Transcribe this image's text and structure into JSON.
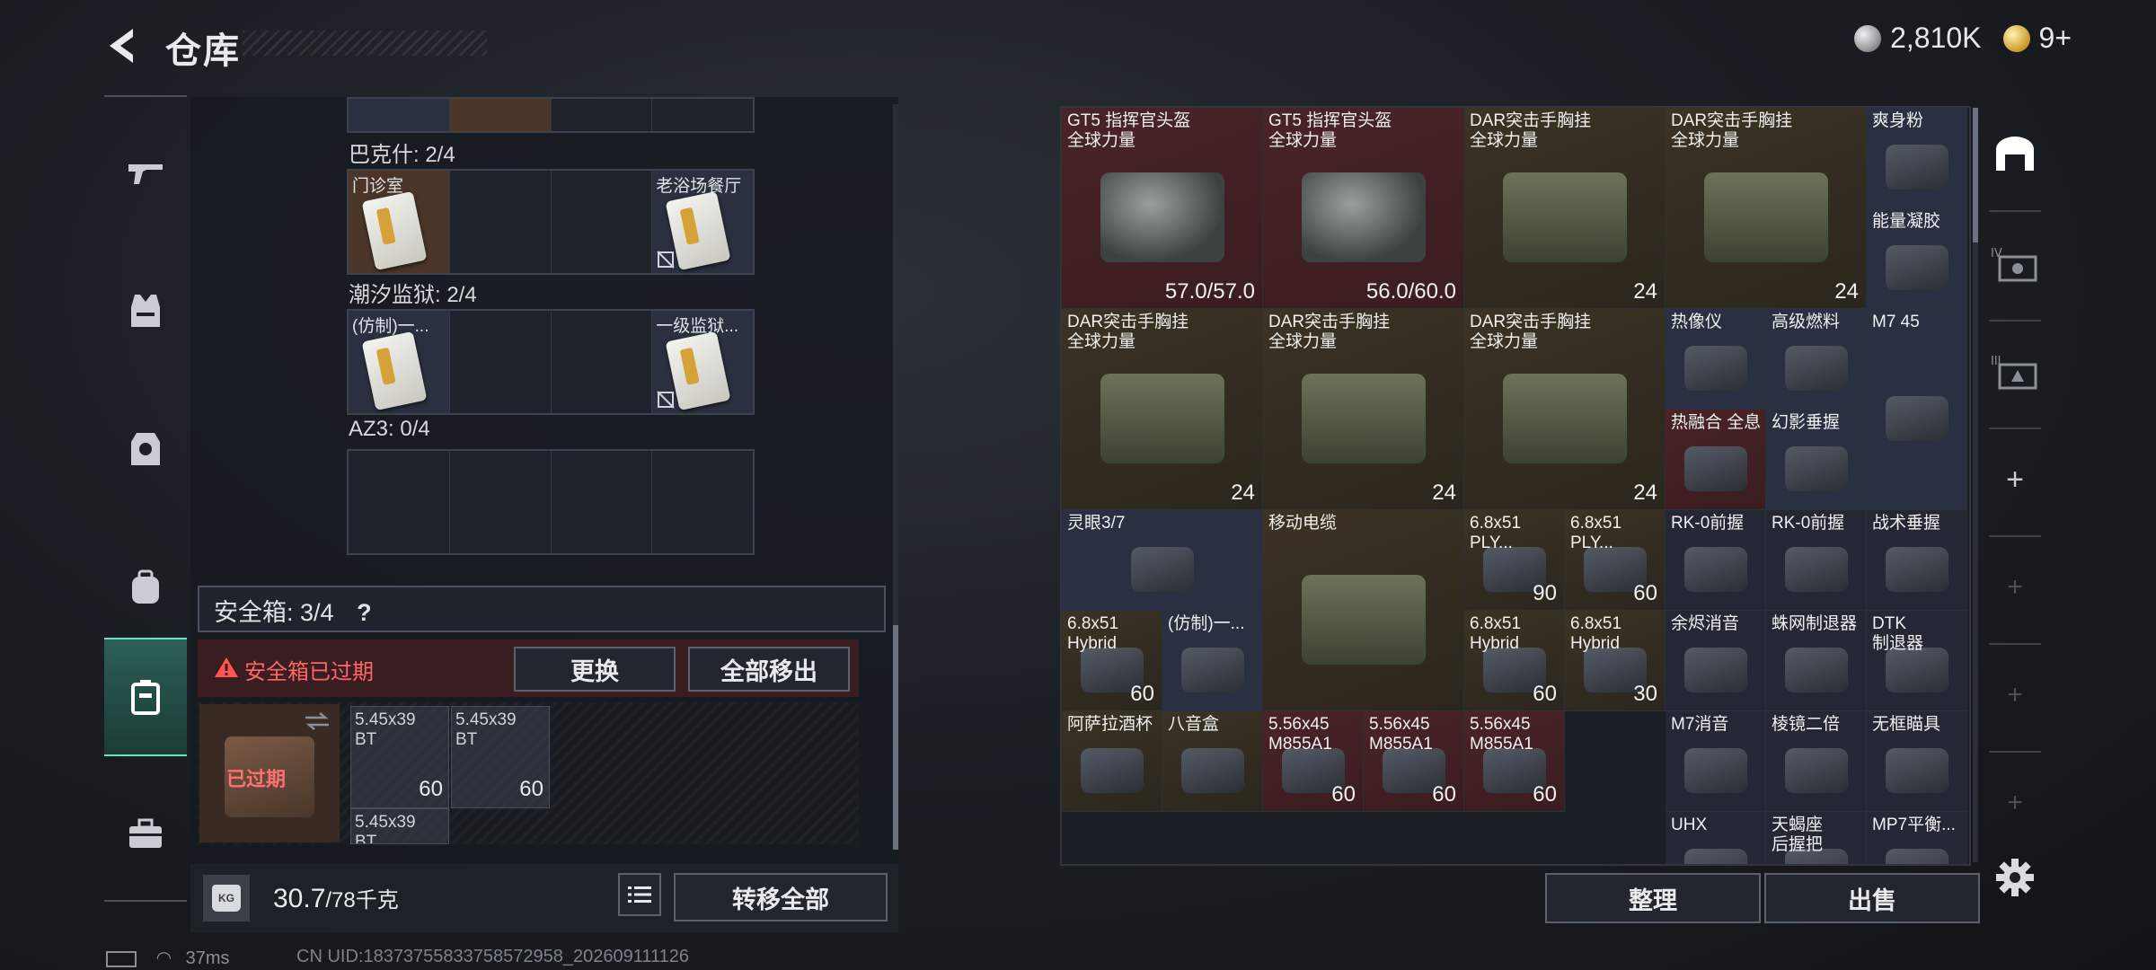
{
  "header": {
    "title": "仓库"
  },
  "currency": {
    "silver": "2,810K",
    "gold": "9+"
  },
  "left_nav": [
    "gun-icon",
    "vest-icon",
    "armor-icon",
    "backpack-icon",
    "safebox-icon",
    "toolbox-icon"
  ],
  "containers": [
    {
      "label": "巴克什: 2/4",
      "cells": [
        {
          "name": "门诊室",
          "filled": true,
          "locked": false
        },
        {
          "name": "",
          "filled": false
        },
        {
          "name": "",
          "filled": false
        },
        {
          "name": "老浴场餐厅",
          "filled": true,
          "locked": true
        }
      ]
    },
    {
      "label": "潮汐监狱: 2/4",
      "cells": [
        {
          "name": "(仿制)一...",
          "filled": true,
          "locked": false
        },
        {
          "name": "",
          "filled": false
        },
        {
          "name": "",
          "filled": false
        },
        {
          "name": "一级监狱...",
          "filled": true,
          "locked": true
        }
      ]
    },
    {
      "label": "AZ3: 0/4",
      "cells": [
        {
          "name": "",
          "filled": false
        },
        {
          "name": "",
          "filled": false
        },
        {
          "name": "",
          "filled": false
        },
        {
          "name": "",
          "filled": false
        }
      ]
    }
  ],
  "safebox": {
    "label": "安全箱: 3/4",
    "help": "?",
    "expired_warning": "安全箱已过期",
    "replace_button": "更换",
    "move_all_button": "全部移出",
    "badge": "已过期",
    "items": [
      {
        "name": "5.45x39\nBT",
        "qty": "60"
      },
      {
        "name": "5.45x39\nBT",
        "qty": "60"
      },
      {
        "name": "5.45x39\nBT",
        "qty": ""
      }
    ]
  },
  "bottom": {
    "weight_value": "30.7",
    "weight_max": "/78千克",
    "weight_icon_text": "KG",
    "transfer_all_button": "转移全部"
  },
  "status": {
    "ping": "37ms",
    "uid": "CN UID:18373755833758572958_202609111126"
  },
  "inventory": [
    {
      "name": "GT5 指挥官头盔\n全球力量",
      "qty": "57.0/57.0",
      "style": "red"
    },
    {
      "name": "GT5 指挥官头盔\n全球力量",
      "qty": "56.0/60.0",
      "style": "red"
    },
    {
      "name": "DAR突击手胸挂\n全球力量",
      "qty": "24",
      "style": "brownc"
    },
    {
      "name": "DAR突击手胸挂\n全球力量",
      "qty": "24",
      "style": "brownc"
    },
    {
      "name": "爽身粉",
      "qty": "",
      "style": "bluec"
    },
    {
      "name": "能量凝胶",
      "qty": "",
      "style": "bluec"
    },
    {
      "name": "DAR突击手胸挂\n全球力量",
      "qty": "24",
      "style": "brownc"
    },
    {
      "name": "DAR突击手胸挂\n全球力量",
      "qty": "24",
      "style": "brownc"
    },
    {
      "name": "DAR突击手胸挂\n全球力量",
      "qty": "24",
      "style": "brownc"
    },
    {
      "name": "热像仪",
      "qty": "",
      "style": "bluec"
    },
    {
      "name": "高级燃料",
      "qty": "",
      "style": "bluec"
    },
    {
      "name": "M7 45",
      "qty": "",
      "style": "bluec"
    },
    {
      "name": "热融合 全息",
      "qty": "",
      "style": "red"
    },
    {
      "name": "幻影垂握",
      "qty": "",
      "style": "bluec"
    },
    {
      "name": "灵眼3/7",
      "qty": "",
      "style": "bluec"
    },
    {
      "name": "移动电缆",
      "qty": "",
      "style": "brownc"
    },
    {
      "name": "6.8x51\nPLY...",
      "qty": "90",
      "style": "brownc"
    },
    {
      "name": "6.8x51\nPLY...",
      "qty": "60",
      "style": "brownc"
    },
    {
      "name": "RK-0前握",
      "qty": "",
      "style": "darkc"
    },
    {
      "name": "RK-0前握",
      "qty": "",
      "style": "darkc"
    },
    {
      "name": "战术垂握",
      "qty": "",
      "style": "darkc"
    },
    {
      "name": "6.8x51\nHybrid",
      "qty": "60",
      "style": "brownc"
    },
    {
      "name": "(仿制)一...",
      "qty": "",
      "style": "bluec"
    },
    {
      "name": "6.8x51\nHybrid",
      "qty": "60",
      "style": "brownc"
    },
    {
      "name": "6.8x51\nHybrid",
      "qty": "30",
      "style": "brownc"
    },
    {
      "name": "余烬消音",
      "qty": "",
      "style": "darkc"
    },
    {
      "name": "蛛网制退器",
      "qty": "",
      "style": "darkc"
    },
    {
      "name": "DTK\n制退器",
      "qty": "",
      "style": "darkc"
    },
    {
      "name": "阿萨拉酒杯",
      "qty": "",
      "style": "brownc"
    },
    {
      "name": "八音盒",
      "qty": "",
      "style": "brownc"
    },
    {
      "name": "5.56x45\nM855A1",
      "qty": "60",
      "style": "red"
    },
    {
      "name": "5.56x45\nM855A1",
      "qty": "60",
      "style": "red"
    },
    {
      "name": "5.56x45\nM855A1",
      "qty": "60",
      "style": "red"
    },
    {
      "name": "M7消音",
      "qty": "",
      "style": "darkc"
    },
    {
      "name": "棱镜二倍",
      "qty": "",
      "style": "darkc"
    },
    {
      "name": "无框瞄具",
      "qty": "",
      "style": "darkc"
    },
    {
      "name": "UHX",
      "qty": "",
      "style": "darkc"
    },
    {
      "name": "天蝎座\n后握把",
      "qty": "",
      "style": "darkc"
    },
    {
      "name": "MP7平衡...",
      "qty": "",
      "style": "darkc"
    }
  ],
  "right_side": [
    "home-icon",
    "tab-4-icon",
    "tab-3-icon",
    "plus-icon"
  ],
  "actions": {
    "arrange": "整理",
    "sell": "出售"
  },
  "colors": {
    "accent": "#2a6e60",
    "warning": "#ff6666",
    "panel": "#1a1e25"
  }
}
